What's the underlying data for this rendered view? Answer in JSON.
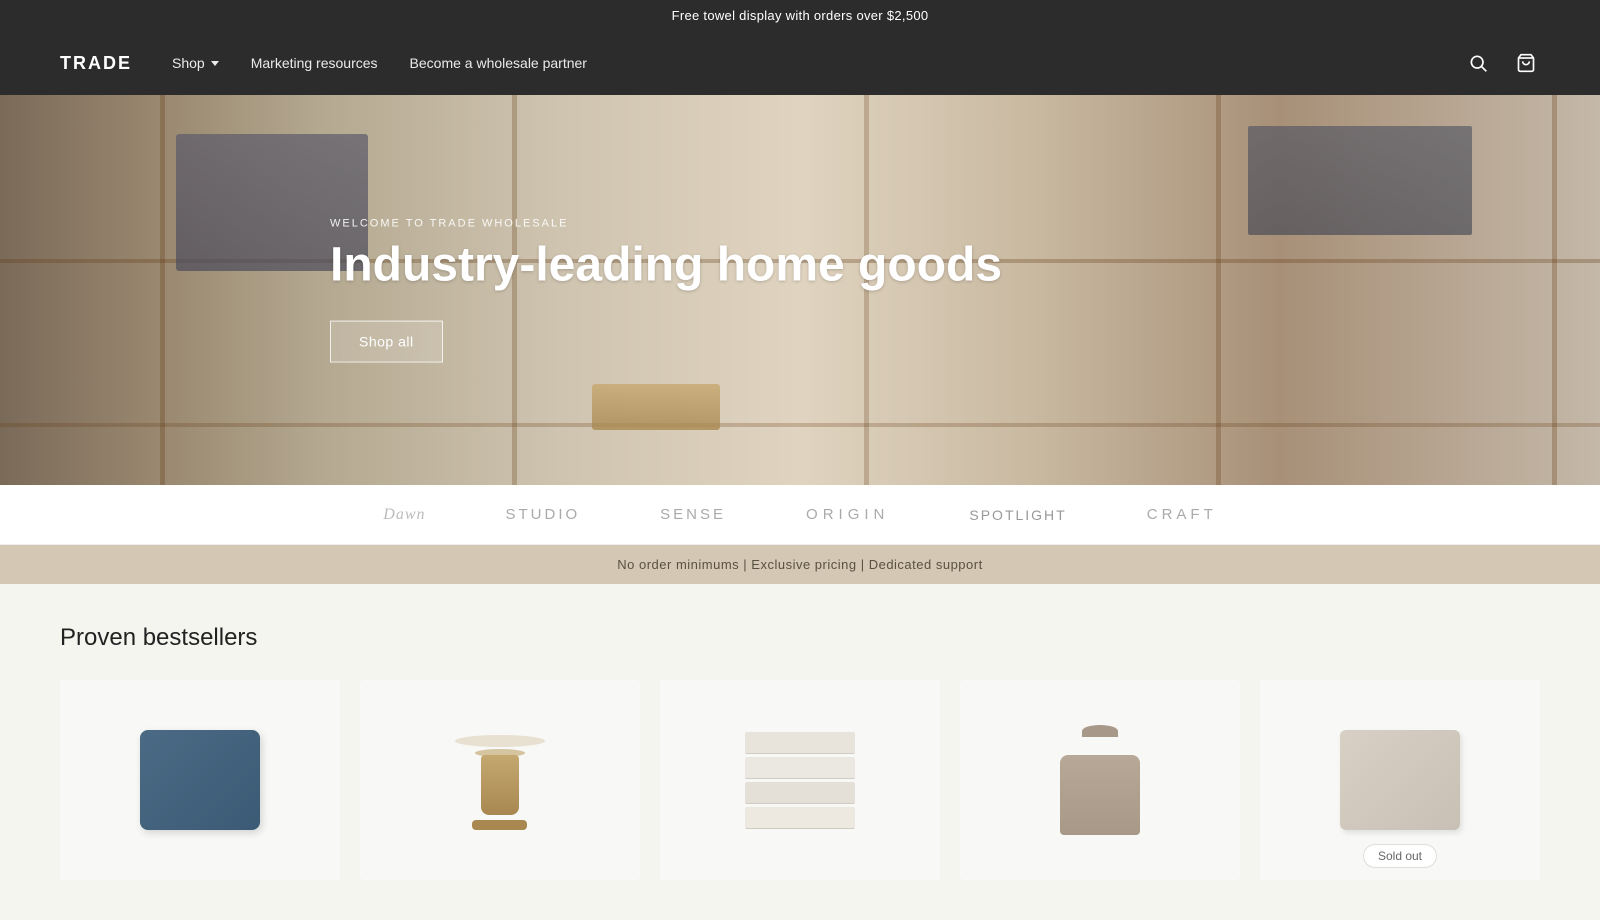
{
  "announcement": {
    "text": "Free towel display with orders over $2,500"
  },
  "nav": {
    "logo": "TRADE",
    "links": [
      {
        "label": "Shop",
        "has_dropdown": true
      },
      {
        "label": "Marketing resources"
      },
      {
        "label": "Become a wholesale partner"
      }
    ]
  },
  "hero": {
    "welcome_text": "WELCOME TO TRADE WHOLESALE",
    "title": "Industry-leading home goods",
    "cta_label": "Shop all"
  },
  "brands": [
    {
      "label": "Dawn",
      "style": "serif"
    },
    {
      "label": "STUDIO",
      "style": "normal"
    },
    {
      "label": "SENSE",
      "style": "normal"
    },
    {
      "label": "ORIGIN",
      "style": "spaced"
    },
    {
      "label": "spotlight",
      "style": "spotlight"
    },
    {
      "label": "CRAFT",
      "style": "normal"
    }
  ],
  "value_props": {
    "text": "No order minimums | Exclusive pricing | Dedicated support"
  },
  "products_section": {
    "title": "Proven bestsellers",
    "products": [
      {
        "id": 1,
        "type": "pillow-blue",
        "sold_out": false
      },
      {
        "id": 2,
        "type": "table",
        "sold_out": false
      },
      {
        "id": 3,
        "type": "towels",
        "sold_out": false
      },
      {
        "id": 4,
        "type": "sweater",
        "sold_out": false
      },
      {
        "id": 5,
        "type": "pillow-beige",
        "sold_out": true,
        "badge": "Sold out"
      }
    ]
  }
}
